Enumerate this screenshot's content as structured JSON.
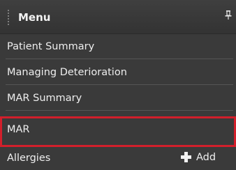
{
  "menu": {
    "title": "Menu",
    "items": [
      {
        "label": "Patient Summary"
      },
      {
        "label": "Managing Deterioration"
      },
      {
        "label": "MAR Summary"
      },
      {
        "label": "MAR",
        "selected": true
      },
      {
        "label": "Allergies",
        "action_label": "Add"
      }
    ]
  },
  "colors": {
    "panel_background": "#3a3a3a",
    "text": "#eeeeee",
    "selection_outline": "#d21f2b"
  },
  "icons": {
    "pin": "pin-icon",
    "add": "plus-icon",
    "grip": "grip-icon"
  }
}
